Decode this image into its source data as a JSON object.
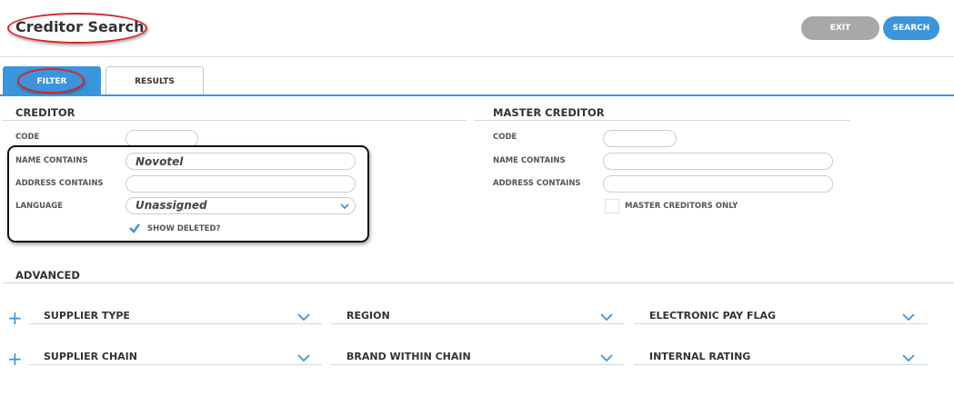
{
  "header": {
    "title": "Creditor Search",
    "exit_label": "EXIT",
    "search_label": "SEARCH"
  },
  "tabs": [
    {
      "label": "FILTER",
      "active": true
    },
    {
      "label": "RESULTS",
      "active": false
    }
  ],
  "creditor": {
    "heading": "CREDITOR",
    "code_label": "CODE",
    "code_value": "",
    "name_label": "NAME CONTAINS",
    "name_value": "Novotel",
    "address_label": "ADDRESS CONTAINS",
    "address_value": "",
    "language_label": "LANGUAGE",
    "language_value": "Unassigned",
    "show_deleted_label": "SHOW DELETED?",
    "show_deleted_checked": true
  },
  "master_creditor": {
    "heading": "MASTER CREDITOR",
    "code_label": "CODE",
    "code_value": "",
    "name_label": "NAME CONTAINS",
    "name_value": "",
    "address_label": "ADDRESS CONTAINS",
    "address_value": "",
    "master_only_label": "MASTER CREDITORS ONLY",
    "master_only_checked": false
  },
  "advanced": {
    "heading": "ADVANCED",
    "rows": [
      [
        "SUPPLIER TYPE",
        "REGION",
        "ELECTRONIC PAY FLAG"
      ],
      [
        "SUPPLIER CHAIN",
        "BRAND WITHIN CHAIN",
        "INTERNAL RATING"
      ]
    ]
  },
  "colors": {
    "accent": "#3b95dc",
    "annotation_red": "#d9232a",
    "exit_gray": "#a8a8a8"
  },
  "icons": [
    "plus-icon",
    "chevron-down-icon",
    "checkmark-icon"
  ]
}
